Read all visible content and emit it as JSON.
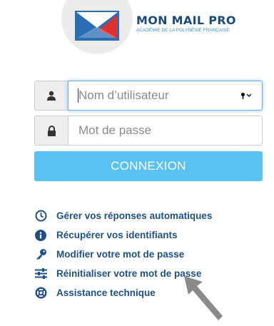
{
  "brand": {
    "name": "MON MAIL PRO",
    "subtitle": "ACADÉMIE DE LA POLYNÉSIE FRANÇAISE"
  },
  "login": {
    "username_placeholder": "Nom d’utilisateur",
    "password_placeholder": "Mot de passe",
    "submit_label": "CONNEXION"
  },
  "links": [
    {
      "label": "Gérer vos réponses automatiques",
      "icon": "clock-icon"
    },
    {
      "label": "Récupérer vos identifiants",
      "icon": "info-circle-icon"
    },
    {
      "label": "Modifier votre mot de passe",
      "icon": "key-icon"
    },
    {
      "label": "Réinitialiser votre mot de passe",
      "icon": "sliders-icon"
    },
    {
      "label": "Assistance technique",
      "icon": "lifebuoy-icon"
    }
  ],
  "colors": {
    "primary_button": "#5ac2f2",
    "link_text": "#1e4f86",
    "brand_text": "#1b4b7a",
    "focus_border": "#66afe9"
  }
}
